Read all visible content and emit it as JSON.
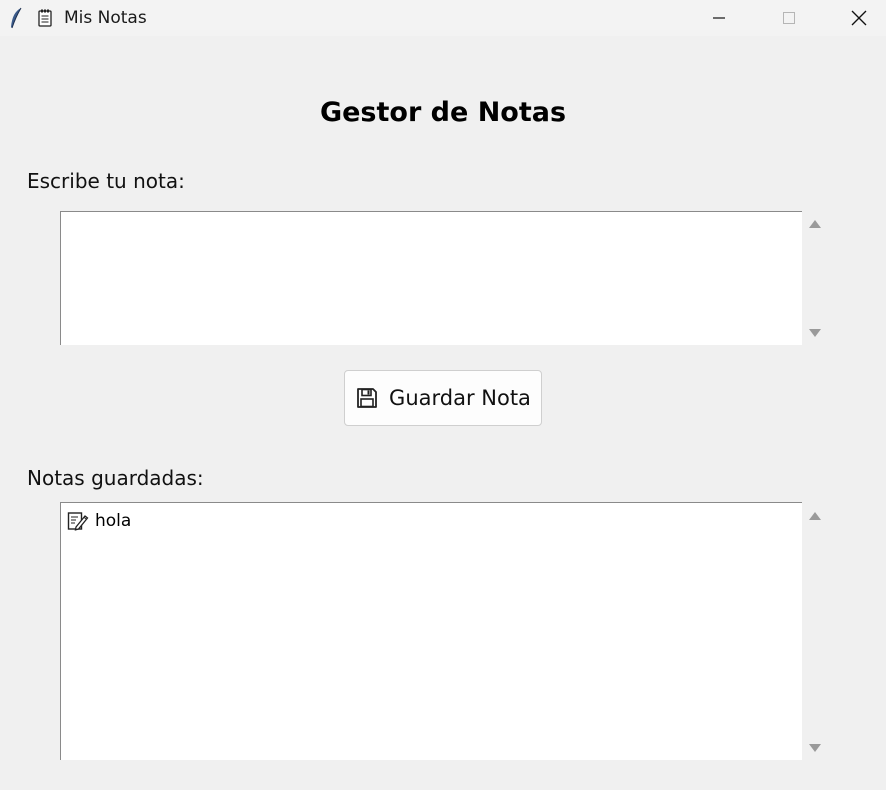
{
  "window": {
    "title": "Mis Notas",
    "app_icon": "feather-icon",
    "doc_icon": "notepad-icon",
    "controls": [
      "minimize-icon",
      "maximize-icon",
      "close-icon"
    ]
  },
  "main": {
    "heading": "Gestor de Notas",
    "input_label": "Escribe tu nota:",
    "input_value": "",
    "save_button": {
      "label": "Guardar Nota",
      "icon": "floppy-disk-icon"
    },
    "list_label": "Notas guardadas:",
    "notes": [
      {
        "text": "hola",
        "icon": "memo-pencil-icon"
      }
    ]
  },
  "colors": {
    "window_bg": "#f0f0f0",
    "titlebar_bg": "#f3f3f3",
    "field_bg": "#ffffff",
    "button_bg": "#fdfdfd"
  }
}
